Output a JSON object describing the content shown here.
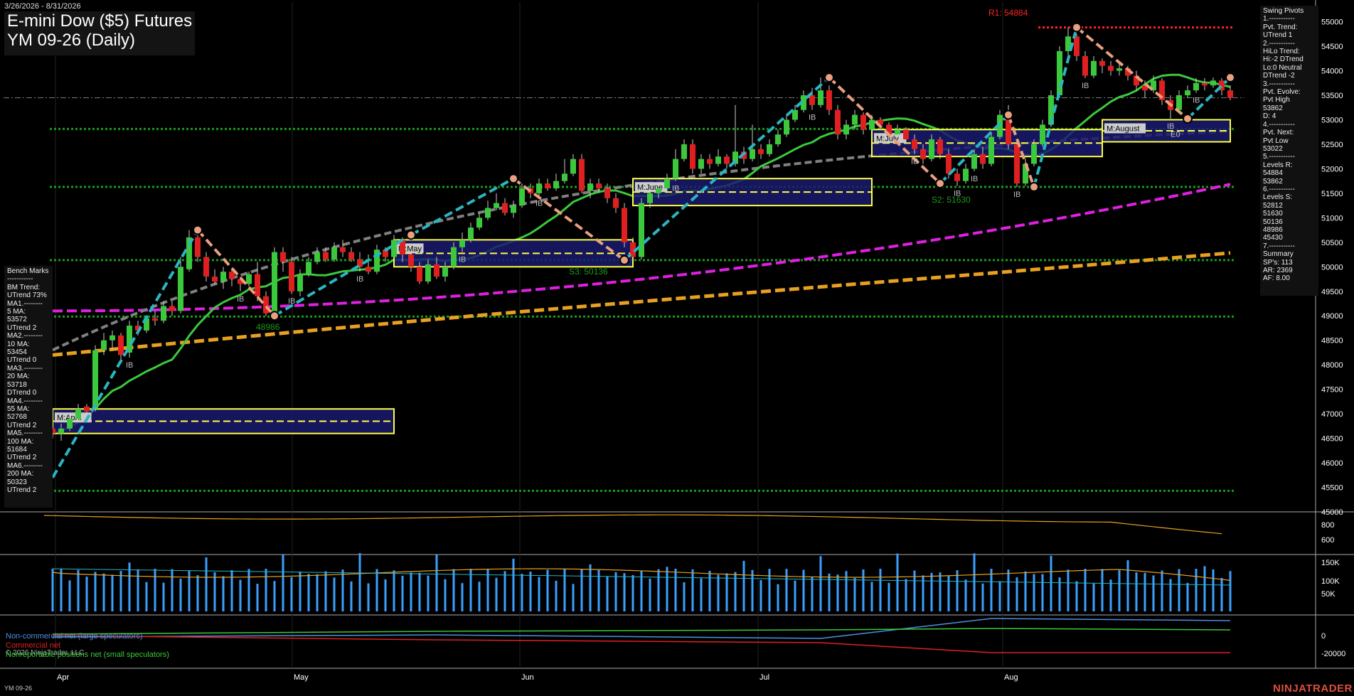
{
  "header": {
    "date_range": "3/26/2026 - 8/31/2026",
    "title_line1": "E-mini Dow ($5) Futures",
    "title_line2": "YM 09-26 (Daily)"
  },
  "footer": {
    "symbol": "YM 09-26",
    "brand": "NINJATRADER",
    "copyright": "© 2026 NinjaTrader, LLC"
  },
  "swing_pivots": [
    "Swing Pivots",
    "1.-----------",
    "Pvt. Trend:",
    "UTrend 1",
    "2.-----------",
    "HiLo Trend:",
    "Hi:-2 DTrend",
    "Lo:0 Neutral",
    "DTrend -2",
    "3.-----------",
    "Pvt. Evolve:",
    "Pvt High",
    "53862",
    "D: 4",
    "4.-----------",
    "Pvt. Next:",
    "Pvt Low",
    "53022",
    "5.-----------",
    "Levels R:",
    "54884",
    "53862",
    "6.-----------",
    "Levels S:",
    "52812",
    "51630",
    "50136",
    "48986",
    "45430",
    "7.-----------",
    "Summary",
    "SP's: 113",
    "AR: 2369",
    "AF: 8.00"
  ],
  "bench_marks": [
    "Bench Marks",
    "-----------",
    "BM Trend:",
    "UTrend 73%",
    "MA1.--------",
    "5 MA:",
    "53572",
    "UTrend 2",
    "MA2.--------",
    "10 MA:",
    "53454",
    "UTrend 0",
    "MA3.--------",
    "20 MA:",
    "53718",
    "DTrend 0",
    "MA4.--------",
    "55 MA:",
    "52768",
    "UTrend 2",
    "MA5.--------",
    "100 MA:",
    "51684",
    "UTrend 2",
    "MA6.--------",
    "200 MA:",
    "50323",
    "UTrend 2"
  ],
  "cot_legend": [
    {
      "label": "Non-commercial net (large speculators)",
      "color": "#4a90e2"
    },
    {
      "label": "Commercial net",
      "color": "#e02020"
    },
    {
      "label": "Nonreportable positions net (small speculators)",
      "color": "#3cc83c"
    }
  ],
  "colors": {
    "bull": "#3cc83c",
    "bear": "#e02020",
    "pivot_up_line": "#2ab5c0",
    "pivot_down_line": "#e8a080",
    "ma200": "#e8a020",
    "ma100": "#e020e0",
    "ma55": "#808080",
    "ma20": "#3cc83c",
    "support": "#1a9a1a",
    "resistance": "#ff2020",
    "box": "#ffff40"
  },
  "chart_data": {
    "type": "candlestick",
    "title": "YM 09-26 (Daily)",
    "y_range": [
      45000,
      55400
    ],
    "y_ticks": [
      45000,
      45500,
      46000,
      46500,
      47000,
      47500,
      48000,
      48500,
      49000,
      49500,
      50000,
      50500,
      51000,
      51500,
      52000,
      52500,
      53000,
      53500,
      54000,
      54500,
      55000
    ],
    "x_labels": [
      "Apr",
      "May",
      "Jun",
      "Jul",
      "Aug"
    ],
    "last_price": 53450,
    "candles": [
      [
        46700,
        46600,
        46750,
        46500
      ],
      [
        46600,
        46700,
        46800,
        46450
      ],
      [
        46700,
        46900,
        47000,
        46650
      ],
      [
        46900,
        47100,
        47200,
        46850
      ],
      [
        47150,
        47050,
        47200,
        46950
      ],
      [
        47100,
        48300,
        48400,
        47050
      ],
      [
        48300,
        48500,
        48650,
        48200
      ],
      [
        48500,
        48600,
        48700,
        48300
      ],
      [
        48600,
        48200,
        48650,
        48100
      ],
      [
        48250,
        48800,
        48900,
        48150
      ],
      [
        48800,
        48700,
        48900,
        48600
      ],
      [
        48700,
        48950,
        49000,
        48650
      ],
      [
        48950,
        48900,
        49100,
        48800
      ],
      [
        48900,
        49200,
        49300,
        48850
      ],
      [
        49200,
        49100,
        49300,
        49000
      ],
      [
        49100,
        50000,
        50200,
        49050
      ],
      [
        49950,
        50600,
        50750,
        49900
      ],
      [
        50600,
        50200,
        50650,
        50100
      ],
      [
        50200,
        49800,
        50300,
        49700
      ],
      [
        49800,
        49700,
        49950,
        49650
      ],
      [
        49700,
        49900,
        50000,
        49550
      ],
      [
        49900,
        49750,
        49950,
        49600
      ],
      [
        49750,
        49650,
        49800,
        49500
      ],
      [
        49650,
        49850,
        49900,
        49600
      ],
      [
        49850,
        49400,
        50100,
        49300
      ],
      [
        49400,
        49050,
        49500,
        49000
      ],
      [
        49050,
        50300,
        50400,
        49000
      ],
      [
        50300,
        50100,
        50400,
        49900
      ],
      [
        50100,
        49500,
        50200,
        49450
      ],
      [
        49500,
        49850,
        49950,
        49400
      ],
      [
        49850,
        50100,
        50200,
        49800
      ],
      [
        50100,
        50300,
        50400,
        50050
      ],
      [
        50300,
        50150,
        50400,
        50100
      ],
      [
        50150,
        50400,
        50500,
        50100
      ],
      [
        50400,
        50300,
        50550,
        50200
      ],
      [
        50300,
        50150,
        50400,
        50100
      ],
      [
        50150,
        50000,
        50300,
        49900
      ],
      [
        50000,
        49900,
        50250,
        49850
      ],
      [
        49900,
        50350,
        50450,
        49850
      ],
      [
        50350,
        50200,
        50400,
        50100
      ],
      [
        50200,
        50550,
        50650,
        50150
      ],
      [
        50550,
        50250,
        50600,
        50100
      ],
      [
        50250,
        50000,
        50300,
        49900
      ],
      [
        50000,
        49700,
        50100,
        49650
      ],
      [
        49700,
        50050,
        50150,
        49650
      ],
      [
        50050,
        49800,
        50200,
        49750
      ],
      [
        49800,
        50000,
        50100,
        49700
      ],
      [
        50000,
        50400,
        50500,
        49950
      ],
      [
        50400,
        50550,
        50700,
        50300
      ],
      [
        50550,
        50800,
        50900,
        50500
      ],
      [
        50800,
        51000,
        51100,
        50750
      ],
      [
        51000,
        51200,
        51350,
        50950
      ],
      [
        51200,
        51300,
        51500,
        51150
      ],
      [
        51300,
        51100,
        51400,
        51050
      ],
      [
        51100,
        51250,
        51350,
        51000
      ],
      [
        51250,
        51600,
        51700,
        51200
      ],
      [
        51600,
        51500,
        51700,
        51400
      ],
      [
        51500,
        51700,
        51800,
        51450
      ],
      [
        51700,
        51600,
        51800,
        51550
      ],
      [
        51600,
        51750,
        51900,
        51550
      ],
      [
        51750,
        51900,
        52200,
        51700
      ],
      [
        51900,
        52200,
        52300,
        51850
      ],
      [
        52200,
        51550,
        52300,
        51500
      ],
      [
        51550,
        51700,
        51800,
        51400
      ],
      [
        51700,
        51600,
        51800,
        51500
      ],
      [
        51600,
        51400,
        51700,
        51300
      ],
      [
        51400,
        51200,
        51500,
        51100
      ],
      [
        51200,
        50500,
        51300,
        50400
      ],
      [
        50500,
        50200,
        50600,
        50136
      ],
      [
        50200,
        51300,
        51400,
        50150
      ],
      [
        51300,
        51500,
        51600,
        51200
      ],
      [
        51500,
        51600,
        51700,
        51400
      ],
      [
        51600,
        51800,
        51900,
        51550
      ],
      [
        51800,
        52200,
        52400,
        51750
      ],
      [
        52200,
        52500,
        52600,
        52150
      ],
      [
        52500,
        52000,
        52600,
        51900
      ],
      [
        52000,
        52200,
        52300,
        51900
      ],
      [
        52200,
        52100,
        52300,
        52000
      ],
      [
        52100,
        52250,
        52400,
        52050
      ],
      [
        52250,
        52100,
        52300,
        52000
      ],
      [
        52100,
        52350,
        53300,
        52050
      ],
      [
        52350,
        52200,
        52450,
        52100
      ],
      [
        52200,
        52400,
        52900,
        52150
      ],
      [
        52400,
        52300,
        52500,
        52200
      ],
      [
        52300,
        52500,
        52600,
        52250
      ],
      [
        52500,
        52700,
        52800,
        52450
      ],
      [
        52700,
        53000,
        53100,
        52650
      ],
      [
        53000,
        53200,
        53300,
        52950
      ],
      [
        53200,
        53500,
        53600,
        53150
      ],
      [
        53500,
        53300,
        53650,
        53200
      ],
      [
        53300,
        53600,
        53862,
        53250
      ],
      [
        53600,
        53200,
        53700,
        53100
      ],
      [
        53200,
        52700,
        53300,
        52600
      ],
      [
        52700,
        52900,
        53000,
        52600
      ],
      [
        52900,
        53100,
        53200,
        52800
      ],
      [
        53100,
        52800,
        53150,
        52700
      ],
      [
        52800,
        53000,
        53100,
        52750
      ],
      [
        53000,
        52900,
        53050,
        52800
      ],
      [
        52900,
        52700,
        52950,
        52600
      ],
      [
        52700,
        52800,
        52900,
        52650
      ],
      [
        52800,
        52600,
        52850,
        52500
      ],
      [
        52600,
        52400,
        52700,
        52300
      ],
      [
        52400,
        52200,
        52500,
        52100
      ],
      [
        52200,
        52600,
        52700,
        52150
      ],
      [
        52600,
        52300,
        52650,
        52200
      ],
      [
        52300,
        51900,
        52400,
        51800
      ],
      [
        51900,
        51750,
        52000,
        51650
      ],
      [
        51750,
        52000,
        52100,
        51700
      ],
      [
        52000,
        52300,
        52400,
        51950
      ],
      [
        52300,
        52100,
        52450,
        52000
      ],
      [
        52100,
        52650,
        52750,
        52050
      ],
      [
        52650,
        53100,
        53200,
        52600
      ],
      [
        53100,
        52500,
        53300,
        52400
      ],
      [
        52500,
        51700,
        52600,
        51630
      ],
      [
        51700,
        52100,
        52200,
        51650
      ],
      [
        52100,
        52500,
        52600,
        52050
      ],
      [
        52500,
        52900,
        53000,
        52450
      ],
      [
        52900,
        53500,
        53600,
        52850
      ],
      [
        53500,
        54400,
        54500,
        53450
      ],
      [
        54400,
        54700,
        54884,
        54300
      ],
      [
        54700,
        54300,
        54750,
        54200
      ],
      [
        54300,
        53900,
        54400,
        53850
      ],
      [
        53900,
        54200,
        54300,
        53850
      ],
      [
        54200,
        54100,
        54250,
        53950
      ],
      [
        54100,
        54000,
        54200,
        53900
      ],
      [
        54000,
        54050,
        54150,
        53900
      ],
      [
        54050,
        53900,
        54100,
        53800
      ],
      [
        53900,
        53700,
        54000,
        53600
      ],
      [
        53700,
        53600,
        53800,
        53450
      ],
      [
        53600,
        53800,
        53900,
        53550
      ],
      [
        53800,
        53400,
        53850,
        53300
      ],
      [
        53400,
        53200,
        53500,
        53022
      ],
      [
        53200,
        53500,
        53600,
        53150
      ],
      [
        53500,
        53600,
        53700,
        53450
      ],
      [
        53600,
        53750,
        53850,
        53550
      ],
      [
        53750,
        53700,
        53850,
        53600
      ],
      [
        53700,
        53800,
        53862,
        53650
      ],
      [
        53800,
        53600,
        53850,
        53500
      ],
      [
        53600,
        53450,
        53700,
        53400
      ]
    ],
    "moving_averages": [
      {
        "name": "MA1 5 MA",
        "value": 53572
      },
      {
        "name": "MA2 10 MA",
        "value": 53454
      },
      {
        "name": "MA3 20 MA",
        "value": 53718
      },
      {
        "name": "MA4 55 MA",
        "value": 52768
      },
      {
        "name": "MA5 100 MA",
        "value": 51684
      },
      {
        "name": "MA6 200 MA",
        "value": 50323
      }
    ],
    "levels": [
      {
        "label": "R1: 54884",
        "price": 54884,
        "kind": "resistance"
      },
      {
        "label": "S2: 51630",
        "price": 51630,
        "kind": "support"
      },
      {
        "label": "S3: 50136",
        "price": 50136,
        "kind": "support"
      },
      {
        "label": "48986",
        "price": 48986,
        "kind": "support"
      },
      {
        "label": "",
        "price": 45430,
        "kind": "support"
      },
      {
        "label": "",
        "price": 52812,
        "kind": "support"
      }
    ],
    "month_boxes": [
      {
        "label": "M:April",
        "top": 47100,
        "bottom": 46600
      },
      {
        "label": "M:May",
        "top": 50550,
        "bottom": 50000
      },
      {
        "label": "M:June",
        "top": 51800,
        "bottom": 51250
      },
      {
        "label": "M:July",
        "top": 52800,
        "bottom": 52250
      },
      {
        "label": "M:August",
        "top": 53000,
        "bottom": 52550
      }
    ],
    "pivot_labels": [
      "IB",
      "IB",
      "IB",
      "IB",
      "IB",
      "IB",
      "IB",
      "IB",
      "IB",
      "IB",
      "IB",
      "IB",
      "IB",
      "IB",
      "IB",
      "E0"
    ],
    "atr_panel": {
      "y_ticks": [
        600,
        800
      ]
    },
    "volume_panel": {
      "y_ticks": [
        "50K",
        "100K",
        "150K"
      ]
    },
    "cot_panel": {
      "y_ticks": [
        0,
        -20000
      ]
    }
  }
}
